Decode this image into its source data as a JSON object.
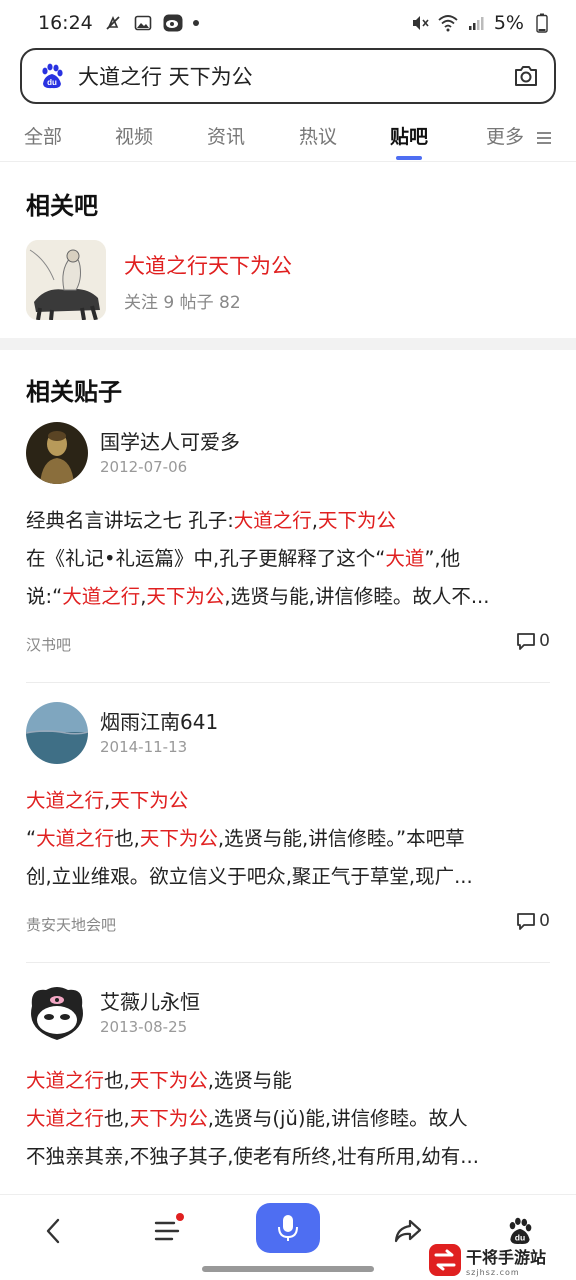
{
  "status_bar": {
    "time": "16:24",
    "battery": "5%"
  },
  "search": {
    "query": "大道之行 天下为公"
  },
  "tabs": [
    {
      "label": "全部"
    },
    {
      "label": "视频"
    },
    {
      "label": "资讯"
    },
    {
      "label": "热议"
    },
    {
      "label": "贴吧"
    },
    {
      "label": "更多"
    }
  ],
  "active_tab": "贴吧",
  "related_bar": {
    "section_title": "相关吧",
    "name": "大道之行天下为公",
    "stats": "关注 9  帖子 82"
  },
  "related_posts": {
    "section_title": "相关贴子",
    "posts": [
      {
        "author": "国学达人可爱多",
        "date": "2012-07-06",
        "lines": [
          [
            {
              "t": "经典名言讲坛之七 孔子:"
            },
            {
              "t": "大道之行",
              "hl": true
            },
            {
              "t": ","
            },
            {
              "t": "天下为公",
              "hl": true
            }
          ],
          [
            {
              "t": "在《礼记•礼运篇》中,孔子更解释了这个“"
            },
            {
              "t": "大道",
              "hl": true
            },
            {
              "t": "”,他"
            }
          ],
          [
            {
              "t": "说:“"
            },
            {
              "t": "大道之行",
              "hl": true
            },
            {
              "t": ","
            },
            {
              "t": "天下为公",
              "hl": true
            },
            {
              "t": ",选贤与能,讲信修睦。故人不..."
            }
          ]
        ],
        "source": "汉书吧",
        "comment_count": "0"
      },
      {
        "author": "烟雨江南641",
        "date": "2014-11-13",
        "lines": [
          [
            {
              "t": "大道之行",
              "hl": true
            },
            {
              "t": ","
            },
            {
              "t": "天下为公",
              "hl": true
            }
          ],
          [
            {
              "t": "“"
            },
            {
              "t": "大道之行",
              "hl": true
            },
            {
              "t": "也,"
            },
            {
              "t": "天下为公",
              "hl": true
            },
            {
              "t": ",选贤与能,讲信修睦。”本吧草"
            }
          ],
          [
            {
              "t": "创,立业维艰。欲立信义于吧众,聚正气于草堂,现广..."
            }
          ]
        ],
        "source": "贵安天地会吧",
        "comment_count": "0"
      },
      {
        "author": "艾薇儿永恒",
        "date": "2013-08-25",
        "lines": [
          [
            {
              "t": "大道之行",
              "hl": true
            },
            {
              "t": "也,"
            },
            {
              "t": "天下为公",
              "hl": true
            },
            {
              "t": ",选贤与能"
            }
          ],
          [
            {
              "t": "大道之行",
              "hl": true
            },
            {
              "t": "也,"
            },
            {
              "t": "天下为公",
              "hl": true
            },
            {
              "t": ",选贤与(jǔ)能,讲信修睦。故人"
            }
          ],
          [
            {
              "t": "不独亲其亲,不独子其子,使老有所终,壮有所用,幼有..."
            }
          ]
        ],
        "source": "",
        "comment_count": ""
      }
    ]
  },
  "watermark": {
    "text": "干将手游站",
    "sub": "szjhsz.com"
  },
  "colors": {
    "highlight": "#e02020",
    "accent": "#4e6ef2"
  },
  "icons": [
    "back-icon",
    "menu-icon",
    "microphone-icon",
    "share-icon",
    "baidu-paw-icon",
    "camera-icon",
    "comment-icon"
  ]
}
